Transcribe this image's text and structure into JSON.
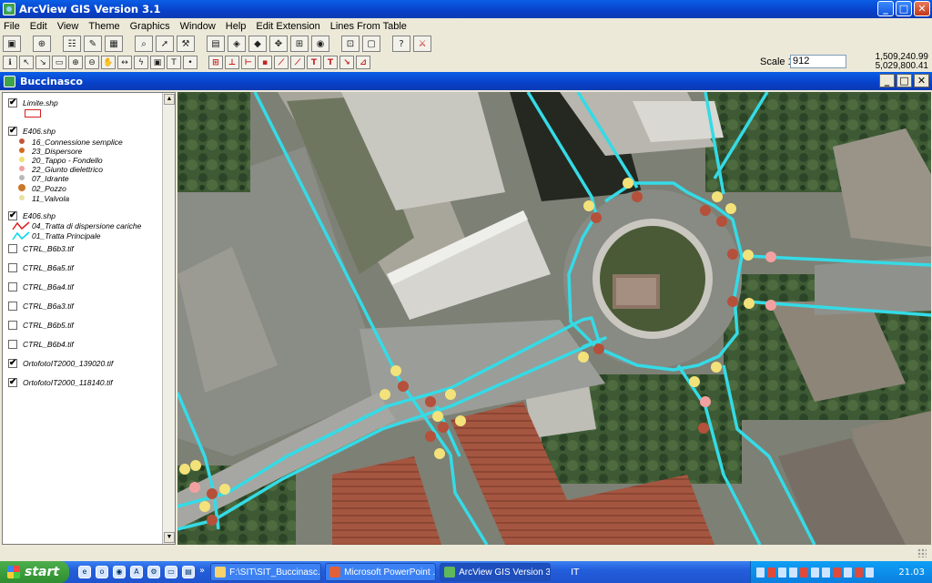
{
  "app": {
    "title": "ArcView GIS Version 3.1"
  },
  "menu": [
    "File",
    "Edit",
    "View",
    "Theme",
    "Graphics",
    "Window",
    "Help",
    "Edit Extension",
    "Lines From Table"
  ],
  "toolbar": {
    "buttons": [
      "save-icon",
      "add-theme-icon",
      "theme-properties-icon",
      "edit-legend-icon",
      "open-table-icon",
      "find-icon",
      "locate-address-icon",
      "query-builder-icon",
      "zoom-full-icon",
      "zoom-active-icon",
      "zoom-selected-icon",
      "zoom-in-icon",
      "zoom-out-icon",
      "zoom-previous-icon",
      "select-by-theme-icon",
      "clear-selection-icon",
      "help-icon",
      "extension-icon"
    ],
    "tools": [
      "identify-icon",
      "pointer-icon",
      "vertex-icon",
      "select-icon",
      "zoom-in-tool-icon",
      "zoom-out-tool-icon",
      "pan-icon",
      "measure-icon",
      "hotlink-icon",
      "area-icon",
      "text-tool-icon",
      "draw-icon"
    ],
    "red_tools": [
      "edit-1-icon",
      "edit-2-icon",
      "edit-3-icon",
      "edit-4-icon",
      "edit-5-icon",
      "edit-6-icon",
      "edit-7-icon",
      "edit-8-icon",
      "edit-9-icon",
      "edit-10-icon"
    ]
  },
  "scale": {
    "label": "Scale 1:",
    "value": "912"
  },
  "coords": {
    "x": "1,509,240.99",
    "y": "5,029,800.41"
  },
  "view": {
    "title": "Buccinasco"
  },
  "toc": {
    "themes": [
      {
        "name": "Limite.shp",
        "checked": true
      },
      {
        "name": "E406.shp",
        "checked": true,
        "legend": [
          {
            "label": "16_Connessione semplice",
            "color": "#c0563a"
          },
          {
            "label": "23_Dispersore",
            "color": "#d2691e"
          },
          {
            "label": "20_Tappo - Fondello",
            "color": "#f0e070"
          },
          {
            "label": "22_Giunto dielettrico",
            "color": "#f0a0a0"
          },
          {
            "label": "07_Idrante",
            "color": "#b8b8b8"
          },
          {
            "label": "02_Pozzo",
            "color": "#c87828"
          },
          {
            "label": "11_Valvola",
            "color": "#e8e0a0"
          }
        ]
      },
      {
        "name": "E406.shp",
        "checked": true,
        "legend": [
          {
            "label": "04_Tratta di dispersione cariche",
            "color": "#e02020"
          },
          {
            "label": "01_Tratta Principale",
            "color": "#00d8e8"
          }
        ]
      },
      {
        "name": "CTRL_B6b3.tif",
        "checked": false
      },
      {
        "name": "CTRL_B6a5.tif",
        "checked": false
      },
      {
        "name": "CTRL_B6a4.tif",
        "checked": false
      },
      {
        "name": "CTRL_B6a3.tif",
        "checked": false
      },
      {
        "name": "CTRL_B6b5.tif",
        "checked": false
      },
      {
        "name": "CTRL_B6b4.tif",
        "checked": false
      },
      {
        "name": "OrtofotoIT2000_139020.tif",
        "checked": true
      },
      {
        "name": "OrtofotoIT2000_118140.tif",
        "checked": true
      }
    ]
  },
  "taskbar": {
    "start": "start",
    "tasks": [
      "F:\\SIT\\SIT_Buccinasc...",
      "Microsoft PowerPoint ...",
      "ArcView GIS Version 3.1"
    ],
    "lang": "IT",
    "clock": "21.03"
  },
  "colors": {
    "pipe": "#34dbe6",
    "point_yellow": "#f3e27a",
    "point_red": "#b5503b",
    "point_pink": "#f2a0a0"
  }
}
